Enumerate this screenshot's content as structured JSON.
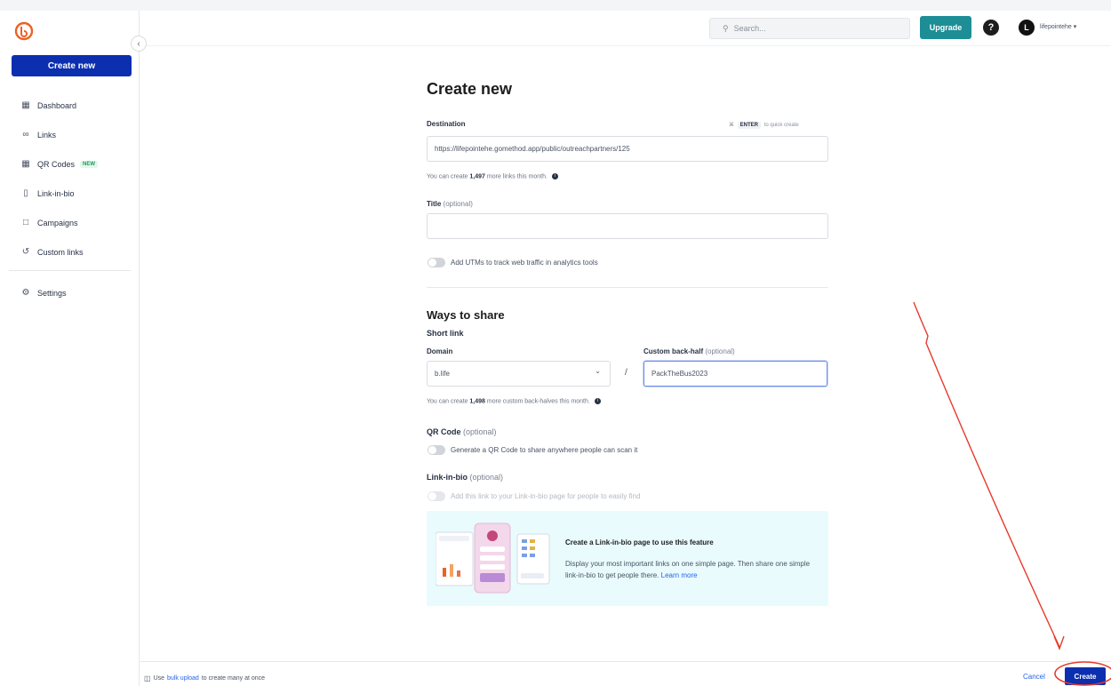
{
  "sidebar": {
    "create_new_label": "Create new",
    "collapse_icon": "chevron-left-icon",
    "items": [
      {
        "label": "Dashboard",
        "icon": "dashboard-icon"
      },
      {
        "label": "Links",
        "icon": "link-icon"
      },
      {
        "label": "QR Codes",
        "icon": "qr-code-icon",
        "badge": "NEW"
      },
      {
        "label": "Link-in-bio",
        "icon": "link-in-bio-icon"
      },
      {
        "label": "Campaigns",
        "icon": "folder-icon"
      },
      {
        "label": "Custom links",
        "icon": "custom-link-icon"
      }
    ],
    "settings_label": "Settings"
  },
  "header": {
    "search_placeholder": "Search...",
    "upgrade_label": "Upgrade",
    "help_icon": "?",
    "avatar_initial": "L",
    "account_name": "lifepointehe ▾"
  },
  "form": {
    "title": "Create new",
    "destination_label": "Destination",
    "quick_create_hint_prefix": "⌘",
    "quick_create_key": "ENTER",
    "quick_create_hint_suffix": "to quick create",
    "destination_value": "https://lifepointehe.gomethod.app/public/outreachpartners/125",
    "links_remaining_prefix": "You can create",
    "links_remaining_count": "1,497",
    "links_remaining_suffix": "more links this month.",
    "title_label": "Title",
    "title_optional": "(optional)",
    "title_value": "",
    "utm_label": "Add UTMs to track web traffic in analytics tools"
  },
  "ways_to_share": {
    "title": "Ways to share",
    "short_link_label": "Short link",
    "domain_label": "Domain",
    "domain_value": "b.life",
    "back_half_label": "Custom back-half",
    "back_half_optional": "(optional)",
    "back_half_value": "PackTheBus2023",
    "backhalves_prefix": "You can create",
    "backhalves_count": "1,498",
    "backhalves_suffix": "more custom back-halves this month.",
    "qr_title": "QR Code",
    "qr_optional": "(optional)",
    "qr_toggle_label": "Generate a QR Code to share anywhere people can scan it",
    "lib_title": "Link-in-bio",
    "lib_optional": "(optional)",
    "lib_toggle_label": "Add this link to your Link-in-bio page for people to easily find",
    "promo_title": "Create a Link-in-bio page to use this feature",
    "promo_text": "Display your most important links on one simple page. Then share one simple link-in-bio to get people there.",
    "promo_link": "Learn more"
  },
  "footer": {
    "bulk_prefix": "Use",
    "bulk_link": "bulk upload",
    "bulk_suffix": "to create many at once",
    "cancel_label": "Cancel",
    "create_label": "Create"
  },
  "colors": {
    "primary": "#0b2fae",
    "upgrade": "#1d8e96",
    "logo": "#ee6123",
    "annotation": "#e8392a",
    "promo_bg": "#e9fbfd"
  }
}
